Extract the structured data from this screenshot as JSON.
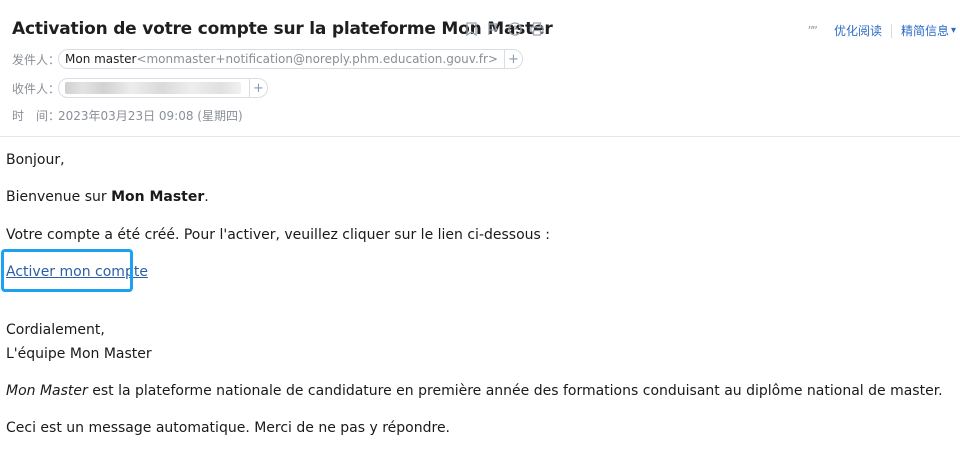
{
  "email": {
    "subject": "Activation de votre compte sur la plateforme Mon Master",
    "subject_icons": [
      "bookmark-icon",
      "flag-icon",
      "clock-icon",
      "print-icon"
    ],
    "toolbar": {
      "quote_glyph": "””",
      "simplified_read": "优化阅读",
      "details": "精简信息"
    },
    "from": {
      "label": "发件人：",
      "name": "Mon master",
      "address": "<monmaster+notification@noreply.phm.education.gouv.fr>",
      "add": "+"
    },
    "to": {
      "label": "收件人：",
      "add": "+"
    },
    "time": {
      "label": "时　间：",
      "value": "2023年03月23日 09:08 (星期四)"
    }
  },
  "body": {
    "greeting": "Bonjour,",
    "welcome_prefix": "Bienvenue sur ",
    "welcome_brand": "Mon Master",
    "welcome_suffix": ".",
    "instructions": "Votre compte a été créé. Pour l'activer, veuillez cliquer sur le lien ci-dessous :",
    "activate_link": "Activer mon compte",
    "closing": "Cordialement,",
    "signature": "L'équipe Mon Master",
    "about_brand": "Mon Master",
    "about_text": " est la plateforme nationale de candidature en première année des formations conduisant au diplôme national de master.",
    "auto_notice": "Ceci est un message automatique. Merci de ne pas y répondre."
  },
  "colors": {
    "link": "#2b5ea7",
    "highlight": "#1da1f2",
    "toolbar_link": "#2b6cc4"
  }
}
